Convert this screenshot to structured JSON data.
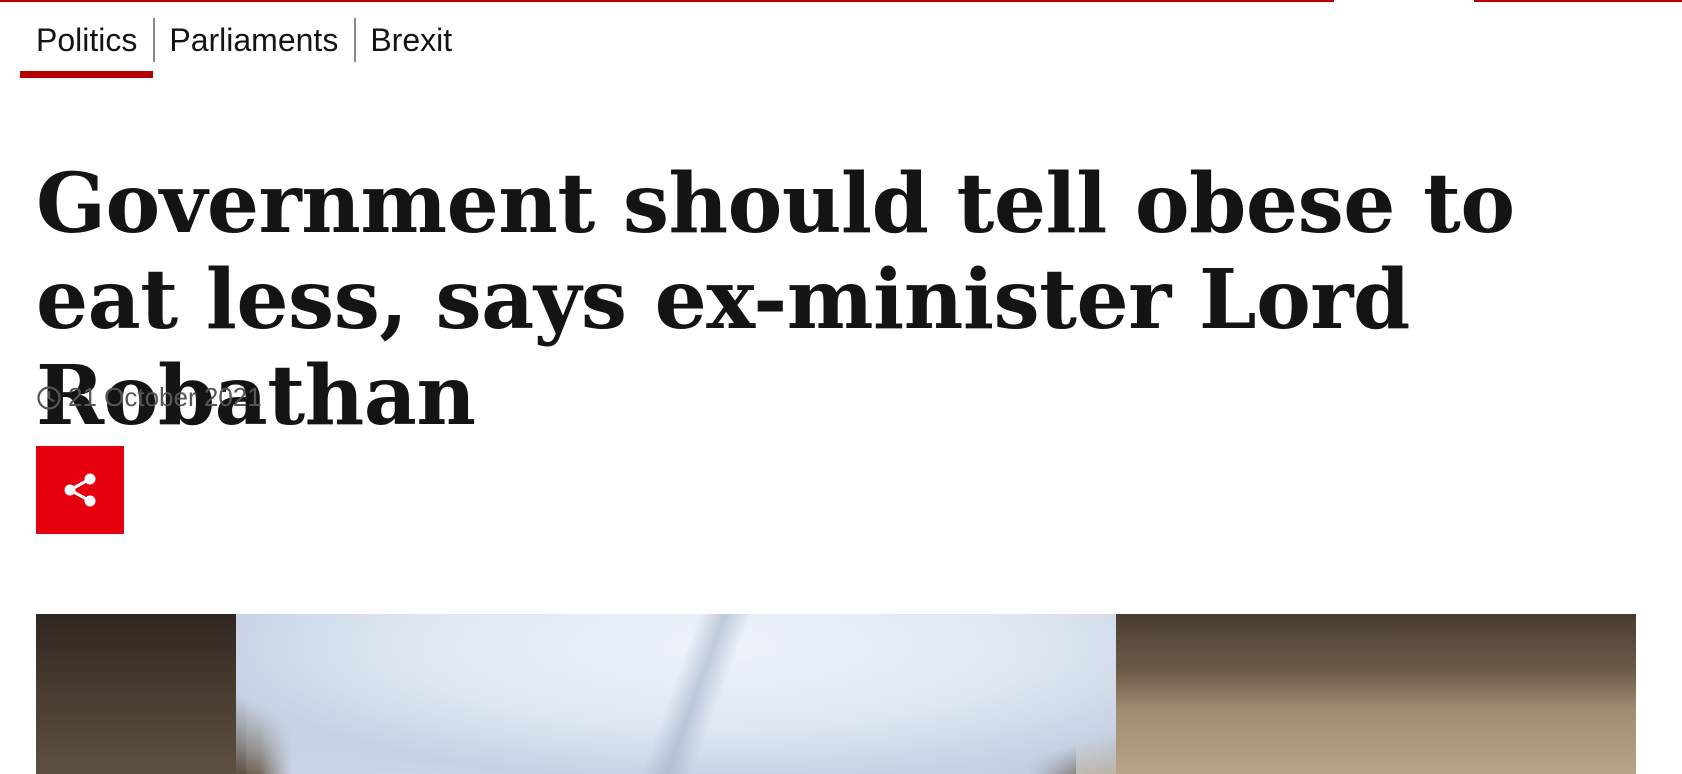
{
  "theme": {
    "accent": "#b80000",
    "share_bg": "#e6000e",
    "headline_color": "#141414",
    "meta_color": "#545658"
  },
  "subnav": {
    "items": [
      {
        "label": "Politics",
        "active": true
      },
      {
        "label": "Parliaments",
        "active": false
      },
      {
        "label": "Brexit",
        "active": false
      }
    ]
  },
  "article": {
    "headline": "Government should tell obese to eat less, says ex-minister Lord Robathan",
    "date": "21 October 2021",
    "date_icon": "clock-icon",
    "share_icon": "share-icon"
  },
  "hero": {
    "description_icon": "photo"
  }
}
